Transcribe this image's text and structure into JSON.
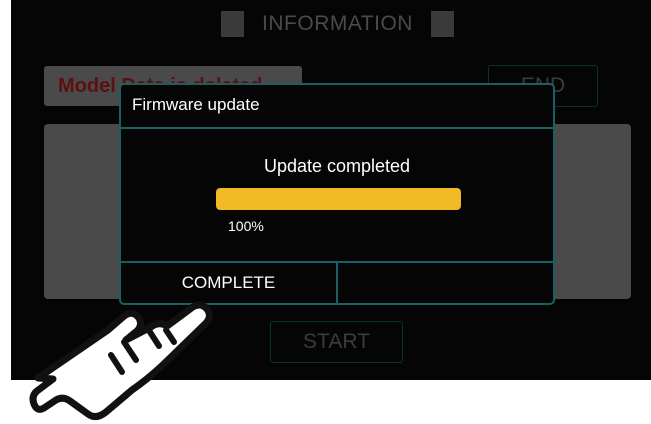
{
  "background": {
    "title": "INFORMATION",
    "model_label": "Model Data is deleted.",
    "end_label": "END",
    "start_label": "START"
  },
  "dialog": {
    "title": "Firmware update",
    "message": "Update completed",
    "progress_percent": 100,
    "progress_text": "100%",
    "buttons": {
      "complete_label": "COMPLETE",
      "right_label": ""
    }
  },
  "colors": {
    "accent_border": "#1a5f66",
    "progress_fill": "#f2bb25",
    "model_text": "#5e0f0f"
  },
  "icons": {
    "pointer": "pointing-hand-icon"
  }
}
